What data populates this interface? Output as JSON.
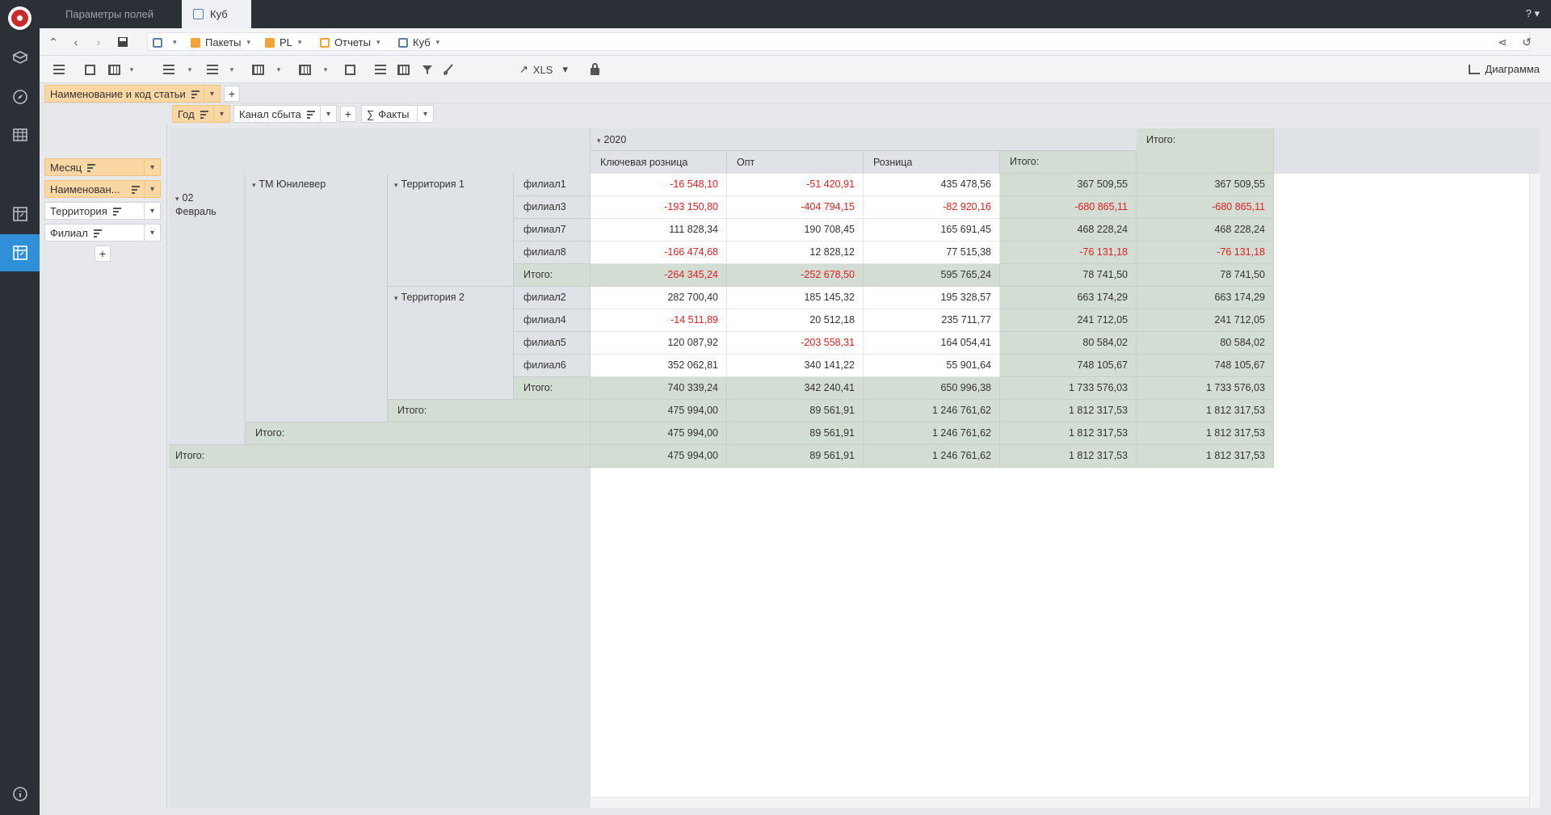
{
  "tabs": [
    {
      "label": "Параметры полей",
      "active": false
    },
    {
      "label": "Куб",
      "active": true
    }
  ],
  "help_label": "?",
  "breadcrumbs": [
    {
      "label": "Пакеты",
      "icon": "package-icon"
    },
    {
      "label": "PL",
      "icon": "package-icon"
    },
    {
      "label": "Отчеты",
      "icon": "reports-icon"
    },
    {
      "label": "Куб",
      "icon": "cube-icon"
    }
  ],
  "toolbar": {
    "export_label": "XLS",
    "chart_label": "Диаграмма"
  },
  "row_filter": {
    "chip": "Наименование и код статьи"
  },
  "col_fields": [
    {
      "label": "Год",
      "style": "orange"
    },
    {
      "label": "Канал сбыта",
      "style": "white"
    },
    {
      "label": "Факты",
      "style": "white"
    }
  ],
  "row_fields": [
    {
      "label": "Месяц",
      "style": "orange"
    },
    {
      "label": "Наименован...",
      "style": "orange"
    },
    {
      "label": "Территория",
      "style": "white"
    },
    {
      "label": "Филиал",
      "style": "white"
    }
  ],
  "pivot": {
    "year": "2020",
    "grand_total_header": "Итого:",
    "columns": [
      "Ключевая розница",
      "Опт",
      "Розница",
      "Итого:"
    ],
    "month": "02\nФевраль",
    "brand": "ТМ Юнилевер",
    "total_label": "Итого:",
    "territories": [
      {
        "name": "Территория 1",
        "rows": [
          {
            "branch": "филиал1",
            "values": [
              "-16 548,10",
              "-51 420,91",
              "435 478,56",
              "367 509,55",
              "367 509,55"
            ]
          },
          {
            "branch": "филиал3",
            "values": [
              "-193 150,80",
              "-404 794,15",
              "-82 920,16",
              "-680 865,11",
              "-680 865,11"
            ]
          },
          {
            "branch": "филиал7",
            "values": [
              "111 828,34",
              "190 708,45",
              "165 691,45",
              "468 228,24",
              "468 228,24"
            ]
          },
          {
            "branch": "филиал8",
            "values": [
              "-166 474,68",
              "12 828,12",
              "77 515,38",
              "-76 131,18",
              "-76 131,18"
            ]
          }
        ],
        "total": [
          "-264 345,24",
          "-252 678,50",
          "595 765,24",
          "78 741,50",
          "78 741,50"
        ]
      },
      {
        "name": "Территория 2",
        "rows": [
          {
            "branch": "филиал2",
            "values": [
              "282 700,40",
              "185 145,32",
              "195 328,57",
              "663 174,29",
              "663 174,29"
            ]
          },
          {
            "branch": "филиал4",
            "values": [
              "-14 511,89",
              "20 512,18",
              "235 711,77",
              "241 712,05",
              "241 712,05"
            ]
          },
          {
            "branch": "филиал5",
            "values": [
              "120 087,92",
              "-203 558,31",
              "164 054,41",
              "80 584,02",
              "80 584,02"
            ]
          },
          {
            "branch": "филиал6",
            "values": [
              "352 062,81",
              "340 141,22",
              "55 901,64",
              "748 105,67",
              "748 105,67"
            ]
          }
        ],
        "total": [
          "740 339,24",
          "342 240,41",
          "650 996,38",
          "1 733 576,03",
          "1 733 576,03"
        ]
      }
    ],
    "brand_total": [
      "475 994,00",
      "89 561,91",
      "1 246 761,62",
      "1 812 317,53",
      "1 812 317,53"
    ],
    "month_total": [
      "475 994,00",
      "89 561,91",
      "1 246 761,62",
      "1 812 317,53",
      "1 812 317,53"
    ],
    "grand_total": [
      "475 994,00",
      "89 561,91",
      "1 246 761,62",
      "1 812 317,53",
      "1 812 317,53"
    ]
  },
  "colors": {
    "accent": "#2f8fd8",
    "negative": "#e01e1e",
    "total_bg": "#d3ddd3",
    "field_orange": "#fbd7a3"
  }
}
